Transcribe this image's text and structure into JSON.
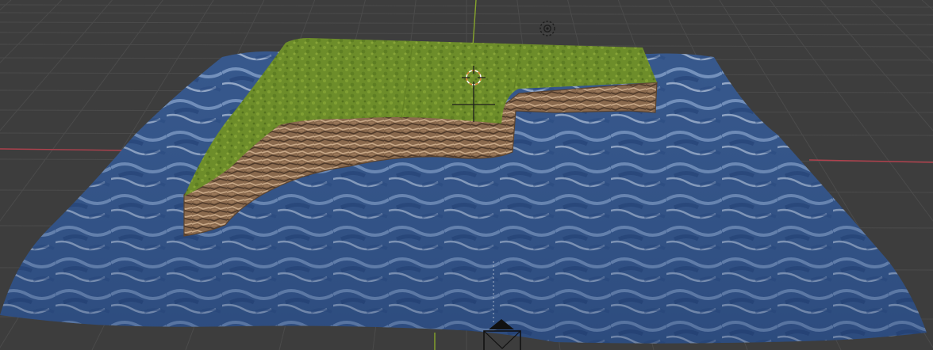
{
  "app": {
    "editor": "3D Viewport"
  },
  "scene": {
    "objects": [
      {
        "name": "ocean-plane",
        "material": "water"
      },
      {
        "name": "cliff-terrain",
        "material": "grass-and-rock"
      },
      {
        "name": "light",
        "type": "point-light"
      },
      {
        "name": "camera",
        "type": "camera"
      }
    ]
  },
  "colors": {
    "background": "#3d3d3d",
    "grid": "#4a4a4a",
    "x_axis": "#b0414d",
    "y_axis": "#7ea129",
    "water": "#36588f",
    "grass": "#6f8f2a",
    "rock": "#8b6a4c",
    "cursor_ring": "#d9842e"
  }
}
